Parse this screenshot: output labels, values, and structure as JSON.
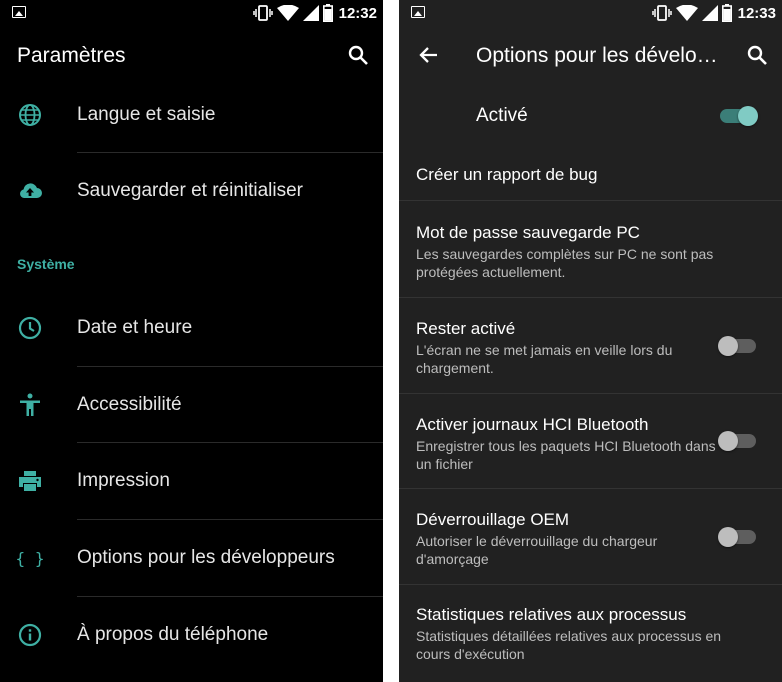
{
  "left": {
    "status_time": "12:32",
    "title": "Paramètres",
    "items_top": [
      {
        "label": "Langue et saisie",
        "icon": "globe-icon"
      },
      {
        "label": "Sauvegarder et réinitialiser",
        "icon": "cloud-upload-icon"
      }
    ],
    "section_header": "Système",
    "items_system": [
      {
        "label": "Date et heure",
        "icon": "clock-icon"
      },
      {
        "label": "Accessibilité",
        "icon": "accessibility-icon"
      },
      {
        "label": "Impression",
        "icon": "printer-icon"
      },
      {
        "label": "Options pour les développeurs",
        "icon": "braces-icon"
      },
      {
        "label": "À propos du téléphone",
        "icon": "info-icon"
      }
    ]
  },
  "right": {
    "status_time": "12:33",
    "title": "Options pour les dévelo…",
    "master_toggle": {
      "label": "Activé",
      "on": true
    },
    "items": [
      {
        "title": "Créer un rapport de bug"
      },
      {
        "title": "Mot de passe sauvegarde PC",
        "subtitle": "Les sauvegardes complètes sur PC ne sont pas protégées actuellement."
      },
      {
        "title": "Rester activé",
        "subtitle": "L'écran ne se met jamais en veille lors du chargement.",
        "toggle": false
      },
      {
        "title": "Activer journaux HCI Bluetooth",
        "subtitle": "Enregistrer tous les paquets HCI Bluetooth dans un fichier",
        "toggle": false
      },
      {
        "title": "Déverrouillage OEM",
        "subtitle": "Autoriser le déverrouillage du chargeur d'amorçage",
        "toggle": false
      },
      {
        "title": "Statistiques relatives aux processus",
        "subtitle": "Statistiques détaillées relatives aux processus en cours d'exécution"
      }
    ]
  },
  "colors": {
    "accent": "#3fb0a4",
    "left_bg": "#000000",
    "right_bg": "#212121",
    "switch_on": "#80cbc4"
  }
}
